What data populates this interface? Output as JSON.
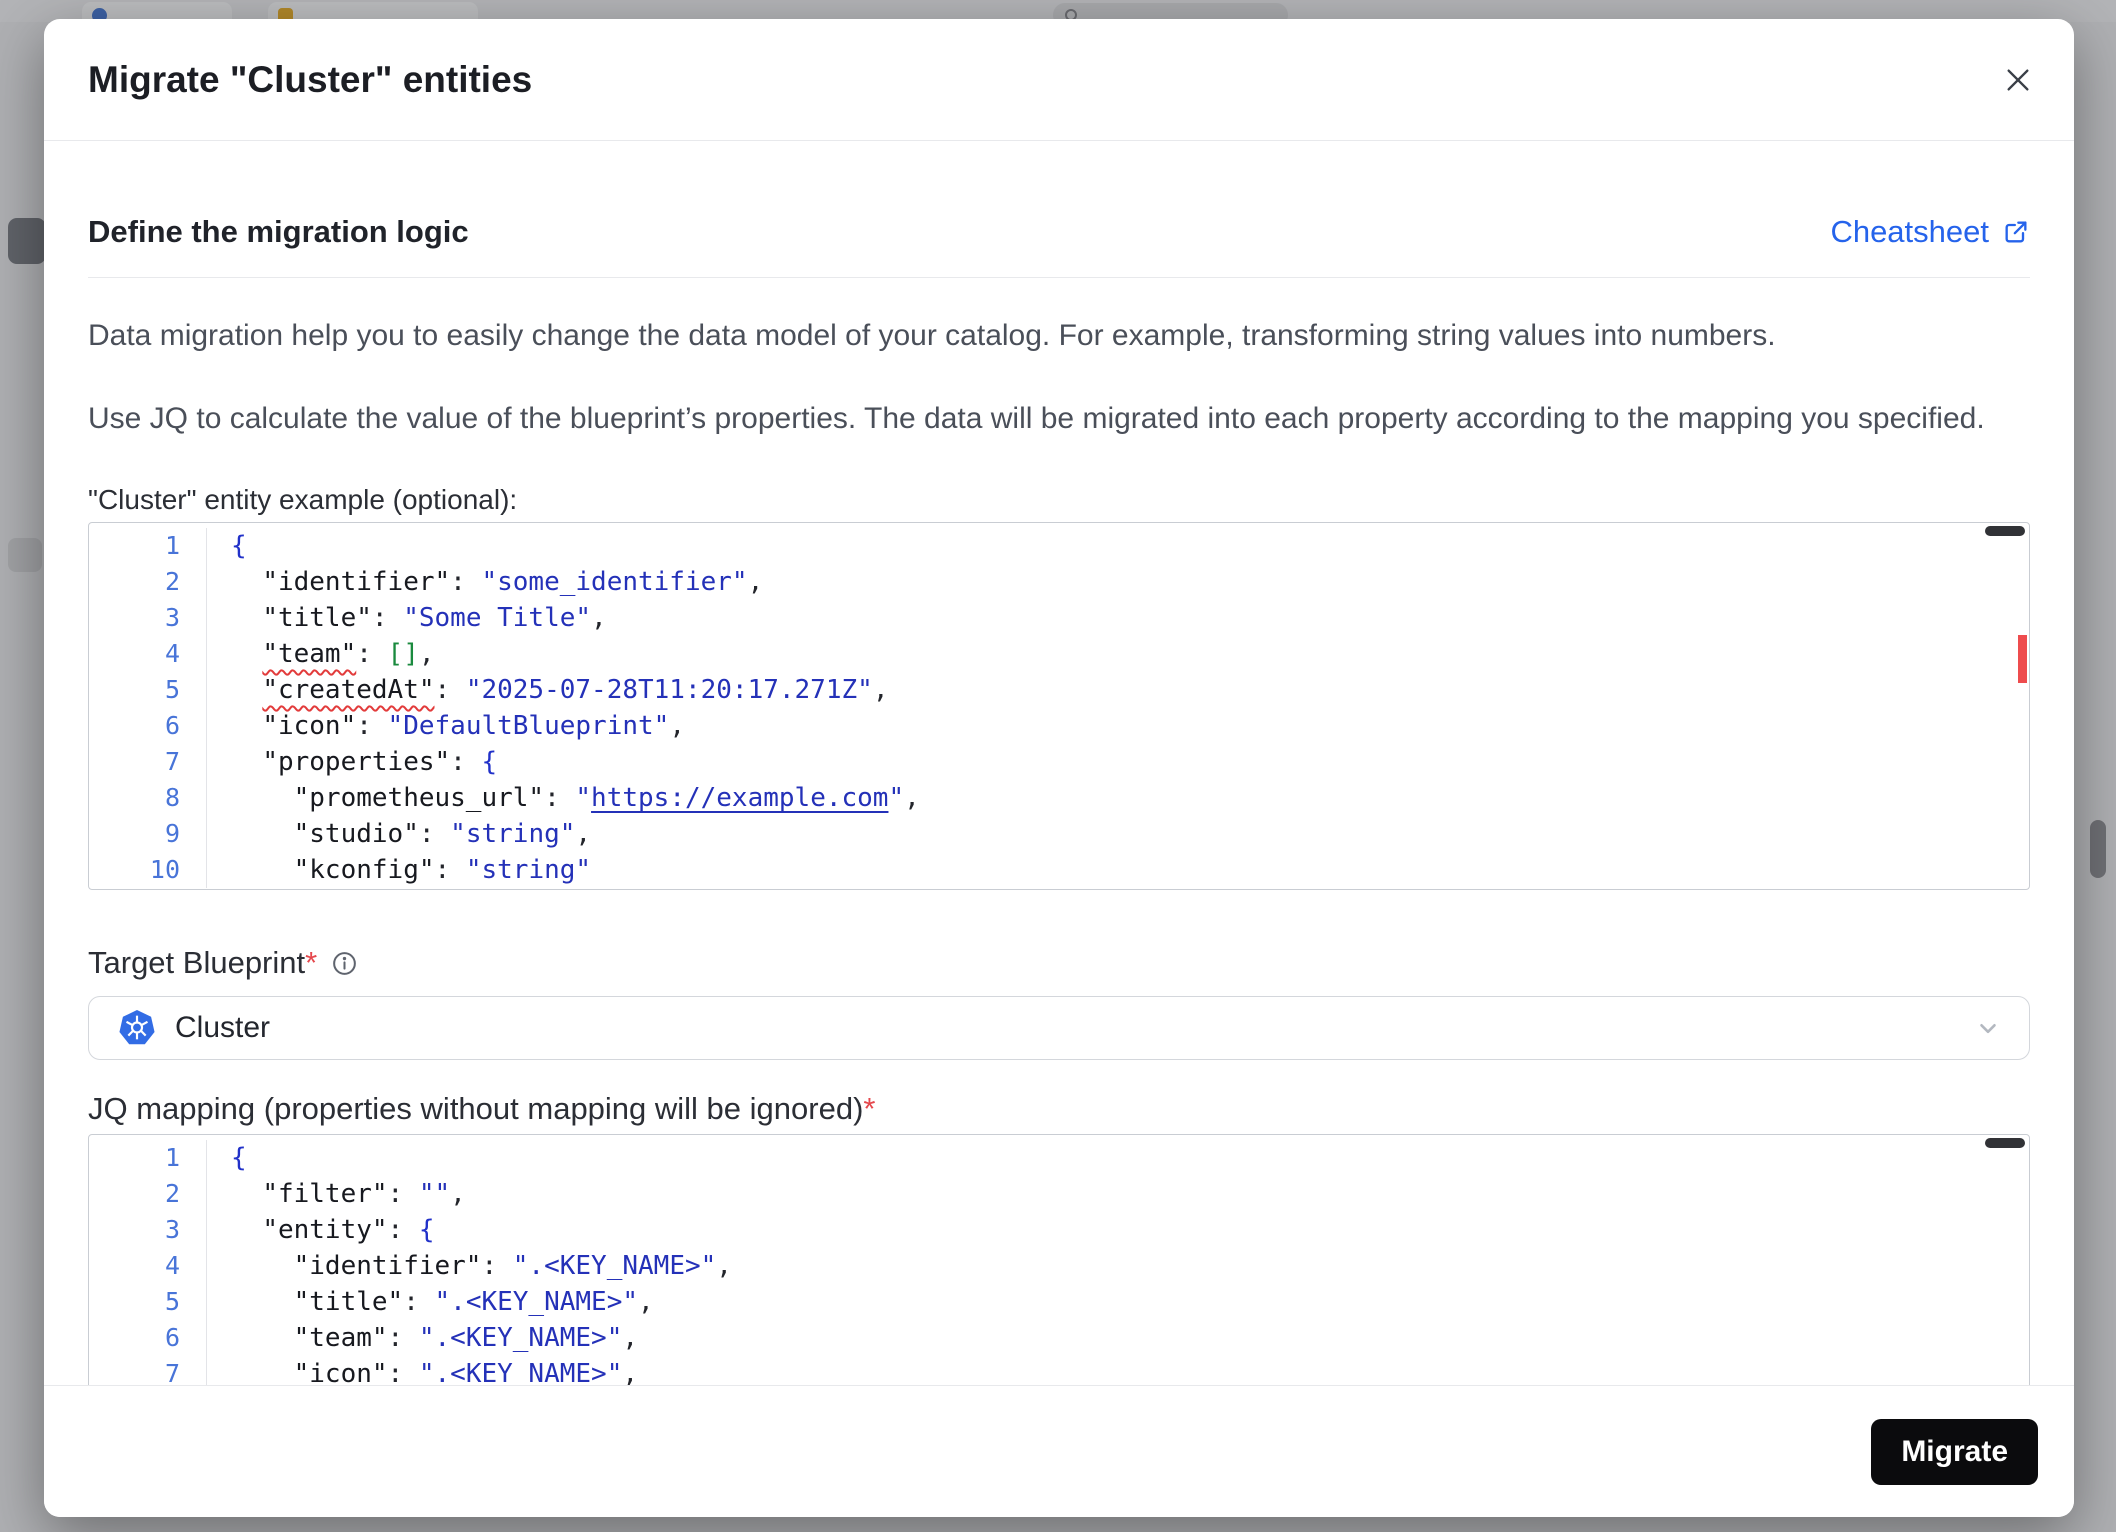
{
  "colors": {
    "accent_link": "#2563eb",
    "kubernetes_blue": "#326ce5",
    "required_red": "#e5484d",
    "error_marker": "#ee4c4e",
    "button_black": "#0b0b0d",
    "code_string": "#2431b8",
    "code_bracket_green": "#1a8a3e",
    "line_number_blue": "#4874d8"
  },
  "modal": {
    "title": "Migrate \"Cluster\" entities",
    "section_heading": "Define the migration logic",
    "cheatsheet_label": "Cheatsheet",
    "description": [
      "Data migration help you to easily change the data model of your catalog. For example, transforming string values into numbers.",
      "Use JQ to calculate the value of the blueprint’s properties. The data will be migrated into each property according to the mapping you specified."
    ],
    "example_label": "\"Cluster\" entity example (optional):",
    "target_blueprint_label": "Target Blueprint",
    "target_blueprint_required": "*",
    "target_blueprint_value": "Cluster",
    "jq_label": "JQ mapping (properties without mapping will be ignored)",
    "jq_required": "*",
    "migrate_button": "Migrate"
  },
  "editors": {
    "example": {
      "lines": [
        [
          [
            "brace",
            "{"
          ]
        ],
        [
          [
            "plain",
            "  "
          ],
          [
            "key",
            "\"identifier\""
          ],
          [
            "plain",
            ": "
          ],
          [
            "str",
            "\"some_identifier\""
          ],
          [
            "plain",
            ","
          ]
        ],
        [
          [
            "plain",
            "  "
          ],
          [
            "key",
            "\"title\""
          ],
          [
            "plain",
            ": "
          ],
          [
            "str",
            "\"Some Title\""
          ],
          [
            "plain",
            ","
          ]
        ],
        [
          [
            "plain",
            "  "
          ],
          [
            "key-err",
            "\"team\""
          ],
          [
            "plain",
            ": "
          ],
          [
            "bracket",
            "[]"
          ],
          [
            "plain",
            ","
          ]
        ],
        [
          [
            "plain",
            "  "
          ],
          [
            "key-err",
            "\"createdAt\""
          ],
          [
            "plain",
            ": "
          ],
          [
            "str",
            "\"2025-07-28T11:20:17.271Z\""
          ],
          [
            "plain",
            ","
          ]
        ],
        [
          [
            "plain",
            "  "
          ],
          [
            "key",
            "\"icon\""
          ],
          [
            "plain",
            ": "
          ],
          [
            "str",
            "\"DefaultBlueprint\""
          ],
          [
            "plain",
            ","
          ]
        ],
        [
          [
            "plain",
            "  "
          ],
          [
            "key",
            "\"properties\""
          ],
          [
            "plain",
            ": "
          ],
          [
            "brace",
            "{"
          ]
        ],
        [
          [
            "plain",
            "    "
          ],
          [
            "key",
            "\"prometheus_url\""
          ],
          [
            "plain",
            ": "
          ],
          [
            "str",
            "\""
          ],
          [
            "link",
            "https://example.com"
          ],
          [
            "str",
            "\""
          ],
          [
            "plain",
            ","
          ]
        ],
        [
          [
            "plain",
            "    "
          ],
          [
            "key",
            "\"studio\""
          ],
          [
            "plain",
            ": "
          ],
          [
            "str",
            "\"string\""
          ],
          [
            "plain",
            ","
          ]
        ],
        [
          [
            "plain",
            "    "
          ],
          [
            "key",
            "\"kconfig\""
          ],
          [
            "plain",
            ": "
          ],
          [
            "str",
            "\"string\""
          ]
        ]
      ]
    },
    "jq": {
      "lines": [
        [
          [
            "brace",
            "{"
          ]
        ],
        [
          [
            "plain",
            "  "
          ],
          [
            "key",
            "\"filter\""
          ],
          [
            "plain",
            ": "
          ],
          [
            "str",
            "\"\""
          ],
          [
            "plain",
            ","
          ]
        ],
        [
          [
            "plain",
            "  "
          ],
          [
            "key",
            "\"entity\""
          ],
          [
            "plain",
            ": "
          ],
          [
            "brace",
            "{"
          ]
        ],
        [
          [
            "plain",
            "    "
          ],
          [
            "key",
            "\"identifier\""
          ],
          [
            "plain",
            ": "
          ],
          [
            "str",
            "\".<KEY_NAME>\""
          ],
          [
            "plain",
            ","
          ]
        ],
        [
          [
            "plain",
            "    "
          ],
          [
            "key",
            "\"title\""
          ],
          [
            "plain",
            ": "
          ],
          [
            "str",
            "\".<KEY_NAME>\""
          ],
          [
            "plain",
            ","
          ]
        ],
        [
          [
            "plain",
            "    "
          ],
          [
            "key",
            "\"team\""
          ],
          [
            "plain",
            ": "
          ],
          [
            "str",
            "\".<KEY_NAME>\""
          ],
          [
            "plain",
            ","
          ]
        ],
        [
          [
            "plain",
            "    "
          ],
          [
            "key",
            "\"icon\""
          ],
          [
            "plain",
            ": "
          ],
          [
            "str",
            "\".<KEY_NAME>\""
          ],
          [
            "plain",
            ","
          ]
        ]
      ]
    }
  }
}
